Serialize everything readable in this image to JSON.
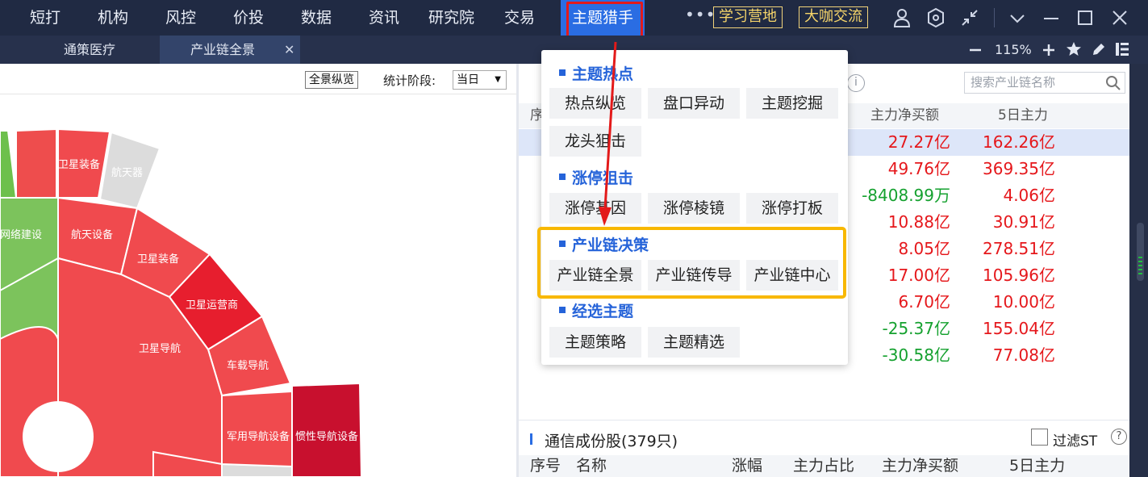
{
  "top_nav": {
    "items": [
      "短打",
      "机构",
      "风控",
      "价投",
      "数据",
      "资讯",
      "研究院",
      "交易"
    ],
    "active": "主题猎手",
    "more": "•••",
    "study_btn": "学习营地",
    "coffee_btn": "大咖交流"
  },
  "tabs": {
    "tab1": "通策医疗",
    "tab2": "产业链全景",
    "close": "✕",
    "zoom": "115%"
  },
  "left_panel": {
    "overview_btn": "全景纵览",
    "stage_label": "统计阶段:",
    "stage_value": "当日",
    "segments": {
      "star_equip_top": "卫星装备",
      "spacecraft": "航天器",
      "network": "网络建设",
      "aerospace_equip": "航天设备",
      "star_equip": "卫星装备",
      "operator": "卫星运营商",
      "navigation": "卫星导航",
      "vehicle_nav": "车载导航",
      "military_nav": "军用导航设备",
      "inertial_nav": "惯性导航设备"
    }
  },
  "right_panel": {
    "info_icon": "i",
    "search_placeholder": "搜索产业链名称",
    "header": {
      "seq": "序",
      "net_buy": "主力净买额",
      "five_day": "5日主力"
    },
    "rows": [
      {
        "net": "27.27亿",
        "five": "162.26亿",
        "net_color": "red",
        "five_color": "red"
      },
      {
        "net": "49.76亿",
        "five": "369.35亿",
        "net_color": "red",
        "five_color": "red"
      },
      {
        "net": "-8408.99万",
        "five": "4.06亿",
        "net_color": "green",
        "five_color": "red"
      },
      {
        "net": "10.88亿",
        "five": "30.91亿",
        "net_color": "red",
        "five_color": "red"
      },
      {
        "net": "8.05亿",
        "five": "278.51亿",
        "net_color": "red",
        "five_color": "red"
      },
      {
        "net": "17.00亿",
        "five": "105.96亿",
        "net_color": "red",
        "five_color": "red"
      },
      {
        "net": "6.70亿",
        "five": "10.00亿",
        "net_color": "red",
        "five_color": "red"
      },
      {
        "net": "-25.37亿",
        "five": "155.04亿",
        "net_color": "green",
        "five_color": "red"
      },
      {
        "net": "-30.58亿",
        "five": "77.08亿",
        "net_color": "green",
        "five_color": "red"
      }
    ],
    "sub_title": "通信成份股(379只)",
    "filter_label": "过滤ST",
    "help": "?",
    "sub_header": [
      "序号",
      "名称",
      "涨幅",
      "主力占比",
      "主力净买额",
      "5日主力"
    ]
  },
  "menu": {
    "sec1": "主题热点",
    "sec1_items": [
      "热点纵览",
      "盘口异动",
      "主题挖掘",
      "龙头狙击"
    ],
    "sec2": "涨停狙击",
    "sec2_items": [
      "涨停基因",
      "涨停棱镜",
      "涨停打板"
    ],
    "sec3": "产业链决策",
    "sec3_items": [
      "产业链全景",
      "产业链传导",
      "产业链中心"
    ],
    "sec4": "经选主题",
    "sec4_items": [
      "主题策略",
      "主题精选"
    ]
  },
  "colors": {
    "nav_bg": "#202a43",
    "active_blue": "#2a6de3",
    "menu_blue": "#2563d9",
    "highlight_red": "#e31a1a",
    "highlight_yellow": "#f8b800",
    "up_red": "#e5171b",
    "down_green": "#15a12f"
  }
}
